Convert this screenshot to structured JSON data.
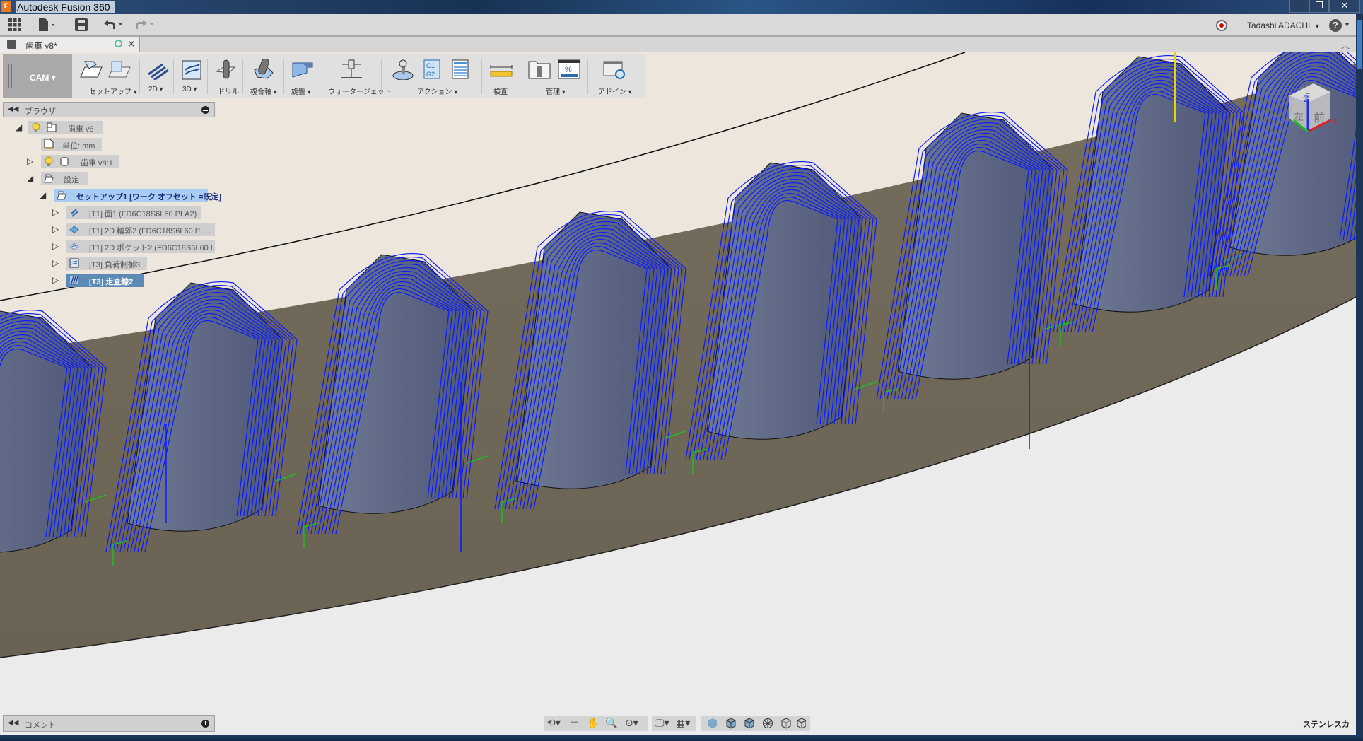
{
  "app": {
    "title": "Autodesk Fusion 360",
    "icon": "F"
  },
  "window_controls": {
    "minimize": "—",
    "restore": "❐",
    "close": "✕"
  },
  "quick_access": {
    "data_panel_icon": "grid-icon",
    "file_icon": "file-icon",
    "save_icon": "save-icon",
    "undo_icon": "undo-icon",
    "redo_icon": "redo-icon",
    "user_name": "Tadashi ADACHI",
    "help_label": "?"
  },
  "document_tab": {
    "label": "歯車 v8*"
  },
  "ribbon": {
    "workspace": "CAM",
    "groups": [
      {
        "label": "セットアップ ▾"
      },
      {
        "label": "2D ▾"
      },
      {
        "label": "3D ▾"
      },
      {
        "label": "ドリル"
      },
      {
        "label": "複合軸 ▾"
      },
      {
        "label": "旋盤 ▾"
      },
      {
        "label": "ウォータージェット"
      },
      {
        "label": "アクション ▾"
      },
      {
        "label": "検査"
      },
      {
        "label": "管理 ▾"
      },
      {
        "label": "アドイン ▾"
      }
    ],
    "action_g1g2": "G1\nG2",
    "manage_percent": "%"
  },
  "browser": {
    "title": "ブラウザ",
    "tree": [
      {
        "label": "歯車 v8",
        "expanded": true
      },
      {
        "label": "単位: mm"
      },
      {
        "label": "歯車 v8:1",
        "expanded": false
      },
      {
        "label": "設定",
        "expanded": true
      },
      {
        "label": "セットアップ1 [ワーク オフセット =既定]",
        "expanded": true,
        "selected": true
      },
      {
        "label": "[T1] 面1 (FD6C18S6L60 PLA2)"
      },
      {
        "label": "[T1] 2D 輪郭2 (FD6C18S6L60 PL..."
      },
      {
        "label": "[T1] 2D ポケット2 (FD6C18S6L60 I..."
      },
      {
        "label": "[T3] 負荷制御3"
      },
      {
        "label": "[T3] 走査線2",
        "active": true
      }
    ]
  },
  "viewcube": {
    "top": "上",
    "front": "前",
    "left": "左",
    "axis_x": "X",
    "axis_z": "Z"
  },
  "comment_panel": {
    "title": "コメント"
  },
  "material_label": "ステンレスカ",
  "colors": {
    "toolpath": "#0a1aff",
    "lead": "#1fbf1f",
    "stock_face": "#6d6554",
    "background_top": "#ede6dc",
    "selected": "#5e8bb5"
  }
}
